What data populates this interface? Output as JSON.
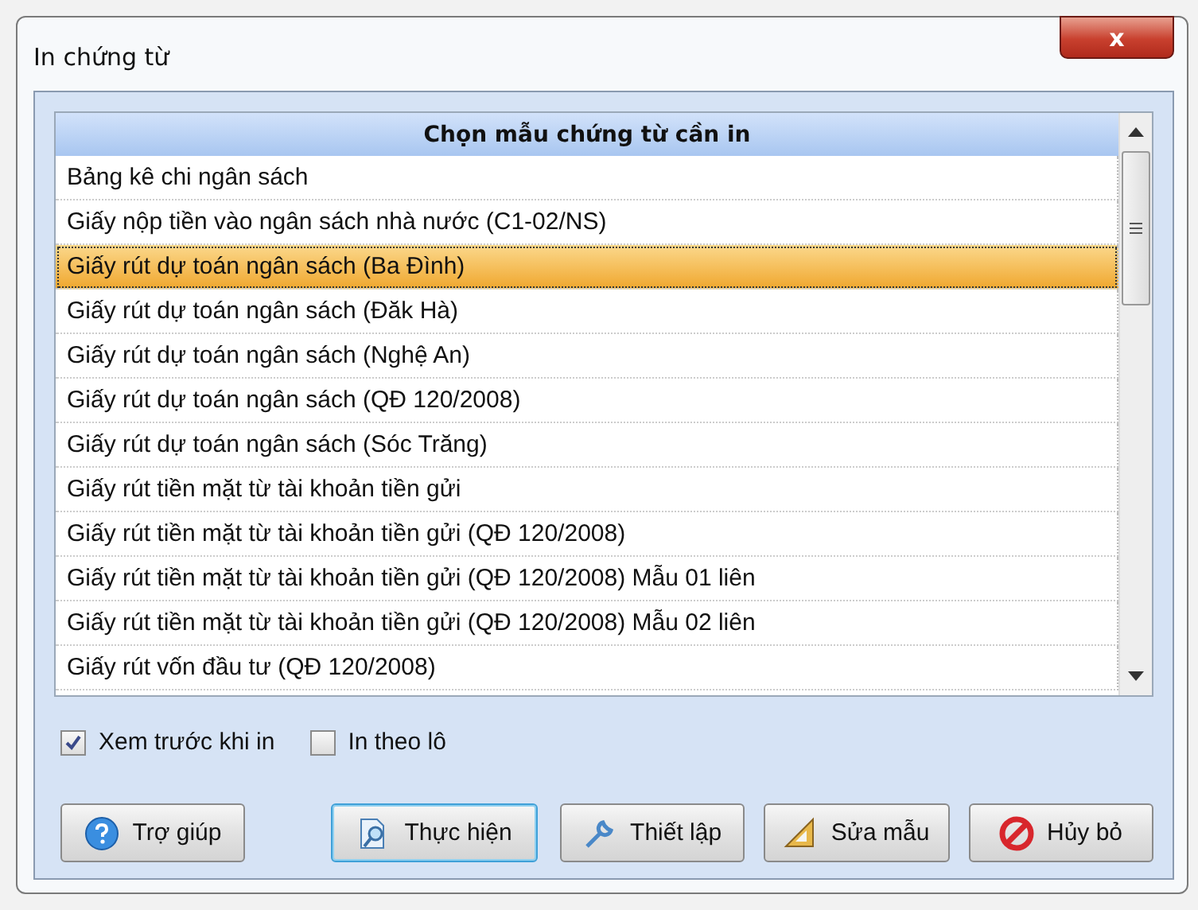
{
  "window": {
    "title": "In chứng từ",
    "close": "x"
  },
  "list": {
    "header": "Chọn mẫu chứng từ cần in",
    "items": [
      {
        "label": "Bảng kê chi ngân sách",
        "selected": false
      },
      {
        "label": "Giấy nộp tiền vào ngân sách nhà nước (C1-02/NS)",
        "selected": false
      },
      {
        "label": "Giấy rút dự toán ngân sách (Ba Đình)",
        "selected": true
      },
      {
        "label": "Giấy rút dự toán ngân sách (Đăk Hà)",
        "selected": false
      },
      {
        "label": "Giấy rút dự toán ngân sách (Nghệ An)",
        "selected": false
      },
      {
        "label": "Giấy rút dự toán ngân sách (QĐ 120/2008)",
        "selected": false
      },
      {
        "label": "Giấy rút dự toán ngân sách (Sóc Trăng)",
        "selected": false
      },
      {
        "label": "Giấy rút tiền mặt từ tài khoản tiền gửi",
        "selected": false
      },
      {
        "label": "Giấy rút tiền mặt từ tài khoản tiền gửi (QĐ 120/2008)",
        "selected": false
      },
      {
        "label": "Giấy rút tiền mặt từ tài khoản tiền gửi (QĐ 120/2008) Mẫu 01 liên",
        "selected": false
      },
      {
        "label": "Giấy rút tiền mặt từ tài khoản tiền gửi (QĐ 120/2008) Mẫu 02 liên",
        "selected": false
      },
      {
        "label": "Giấy rút vốn đầu tư (QĐ 120/2008)",
        "selected": false
      }
    ]
  },
  "options": [
    {
      "label": "Xem trước khi in",
      "checked": true
    },
    {
      "label": "In theo lô",
      "checked": false
    }
  ],
  "buttons": [
    {
      "label": "Trợ giúp",
      "kind": "help",
      "focused": false
    },
    {
      "label": "Thực hiện",
      "kind": "run",
      "focused": true
    },
    {
      "label": "Thiết lập",
      "kind": "setup",
      "focused": false
    },
    {
      "label": "Sửa mẫu",
      "kind": "edit",
      "focused": false
    },
    {
      "label": "Hủy bỏ",
      "kind": "cancel",
      "focused": false
    }
  ]
}
